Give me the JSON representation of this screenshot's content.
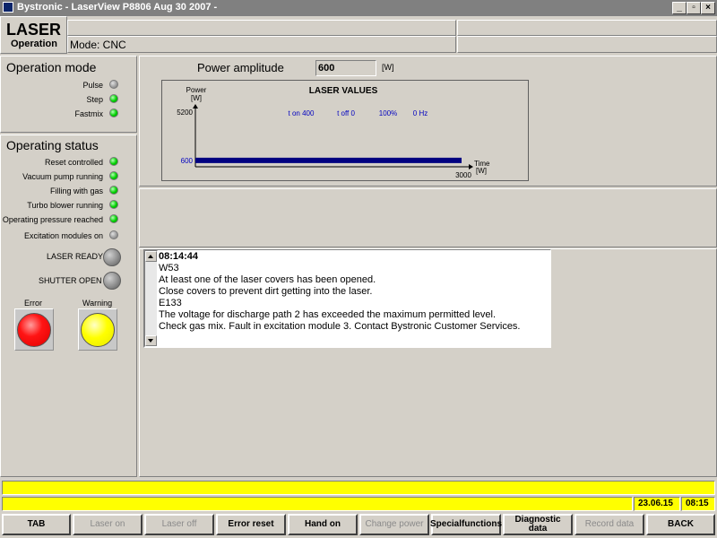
{
  "window": {
    "title": "Bystronic - LaserView P8806  Aug 30 2007 -",
    "minimize": "_",
    "restore": "▫",
    "close": "×"
  },
  "header": {
    "module": "LASER",
    "subtitle": "Operation",
    "mode": "Mode: CNC"
  },
  "operation_mode": {
    "title": "Operation mode",
    "items": [
      {
        "label": "Pulse",
        "state": "grey"
      },
      {
        "label": "Step",
        "state": "green"
      },
      {
        "label": "Fastmix",
        "state": "green"
      }
    ]
  },
  "operating_status": {
    "title": "Operating status",
    "items": [
      {
        "label": "Reset controlled",
        "state": "green"
      },
      {
        "label": "Vacuum pump running",
        "state": "green"
      },
      {
        "label": "Filling with gas",
        "state": "green"
      },
      {
        "label": "Turbo blower running",
        "state": "green"
      },
      {
        "label": "Operating pressure reached",
        "state": "green"
      },
      {
        "label": "Excitation modules on",
        "state": "grey"
      }
    ],
    "laser_ready": "LASER READY",
    "shutter_open": "SHUTTER OPEN",
    "error_label": "Error",
    "warning_label": "Warning"
  },
  "power": {
    "label": "Power amplitude",
    "value": "600",
    "unit": "[W]"
  },
  "chart_data": {
    "type": "line",
    "title": "LASER VALUES",
    "ylabel_top": "Power",
    "ylabel_unit": "[W]",
    "xlabel": "Time",
    "xlabel_unit": "[W]",
    "y_max_label": "5200",
    "y_value_label": "600",
    "x_max_label": "3000",
    "ylim": [
      0,
      5200
    ],
    "xlim": [
      0,
      3000
    ],
    "series": [
      {
        "x": [
          0,
          3000
        ],
        "y": [
          600,
          600
        ]
      }
    ],
    "params": [
      "t on 400",
      "t off 0",
      "100%",
      "0 Hz"
    ],
    "colors": {
      "series": "#000080",
      "params": "#0000c0",
      "y_value": "#0000c0"
    }
  },
  "messages": {
    "lines": [
      "08:14:44",
      "W53",
      "At least one of the laser covers has been opened.",
      "Close covers to prevent dirt getting into the laser.",
      "E133",
      "The voltage for discharge path 2 has exceeded the maximum permitted level.",
      "Check gas mix. Fault in excitation module 3. Contact Bystronic Customer Services."
    ]
  },
  "statusbar": {
    "date": "23.06.15",
    "time": "08:15",
    "color": "#ffff00"
  },
  "fkeys": [
    {
      "label": "TAB",
      "enabled": true
    },
    {
      "label": "Laser on",
      "enabled": false
    },
    {
      "label": "Laser off",
      "enabled": false
    },
    {
      "label": "Error reset",
      "enabled": true
    },
    {
      "label": "Hand on",
      "enabled": true
    },
    {
      "label": "Change power",
      "enabled": false
    },
    {
      "label": "Special functions",
      "enabled": true
    },
    {
      "label": "Diagnostic data",
      "enabled": true
    },
    {
      "label": "Record data",
      "enabled": false
    },
    {
      "label": "BACK",
      "enabled": true
    }
  ]
}
